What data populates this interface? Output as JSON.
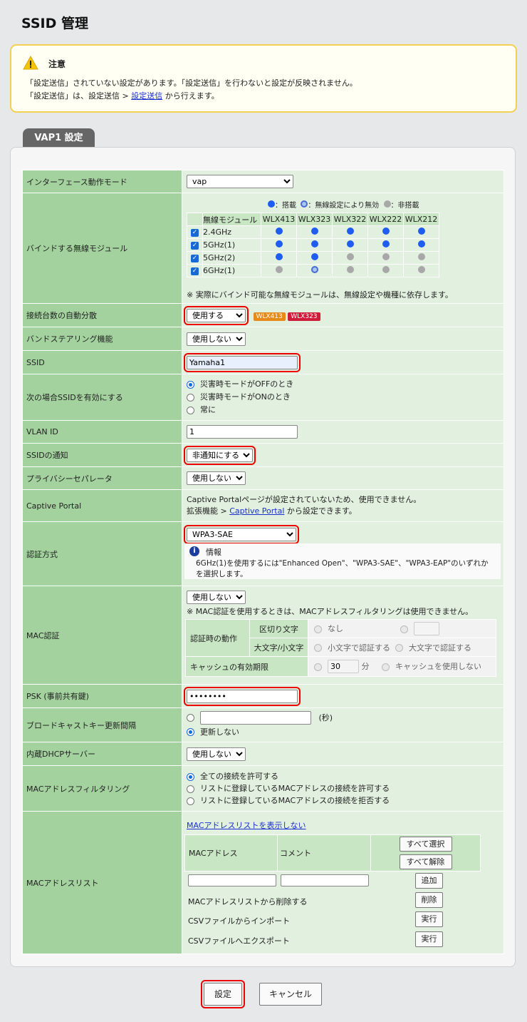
{
  "page_title": "SSID 管理",
  "notice": {
    "title": "注意",
    "line1": "「設定送信」されていない設定があります。「設定送信」を行わないと設定が反映されません。",
    "line2_pre": "「設定送信」は、設定送信 > ",
    "line2_link": "設定送信",
    "line2_post": " から行えます。"
  },
  "tab": "VAP1 設定",
  "rows": {
    "interface_mode": {
      "label": "インターフェース動作モード",
      "value": "vap"
    },
    "bind": {
      "label": "バインドする無線モジュール",
      "legend_on": "：搭載",
      "legend_disabled": "：無線設定により無効",
      "legend_none": "：非搭載",
      "col_module": "無線モジュール",
      "models": [
        "WLX413",
        "WLX323",
        "WLX322",
        "WLX222",
        "WLX212"
      ],
      "modules": [
        {
          "name": "2.4GHz",
          "dots": [
            "b",
            "b",
            "b",
            "b",
            "b"
          ]
        },
        {
          "name": "5GHz(1)",
          "dots": [
            "b",
            "b",
            "b",
            "b",
            "b"
          ]
        },
        {
          "name": "5GHz(2)",
          "dots": [
            "b",
            "b",
            "g",
            "g",
            "g"
          ]
        },
        {
          "name": "6GHz(1)",
          "dots": [
            "g",
            "r",
            "g",
            "g",
            "g"
          ]
        }
      ],
      "note": "※ 実際にバインド可能な無線モジュールは、無線設定や機種に依存します。"
    },
    "auto_distribution": {
      "label": "接続台数の自動分散",
      "value": "使用する",
      "tag1": "WLX413",
      "tag2": "WLX323"
    },
    "band_steering": {
      "label": "バンドステアリング機能",
      "value": "使用しない"
    },
    "ssid": {
      "label": "SSID",
      "value": "Yamaha1"
    },
    "enable_when": {
      "label": "次の場合SSIDを有効にする",
      "options": [
        "災害時モードがOFFのとき",
        "災害時モードがONのとき",
        "常に"
      ],
      "selected": 0
    },
    "vlan": {
      "label": "VLAN ID",
      "value": "1"
    },
    "ssid_notify": {
      "label": "SSIDの通知",
      "value": "非通知にする"
    },
    "privacy": {
      "label": "プライバシーセパレータ",
      "value": "使用しない"
    },
    "captive": {
      "label": "Captive Portal",
      "line1": "Captive Portalページが設定されていないため、使用できません。",
      "line2_pre": "拡張機能 > ",
      "line2_link": "Captive Portal",
      "line2_post": " から設定できます。"
    },
    "auth": {
      "label": "認証方式",
      "value": "WPA3-SAE",
      "info_title": "情報",
      "info_l1": "6GHz(1)を使用するには\"Enhanced Open\"、\"WPA3-SAE\"、\"WPA3-EAP\"のいずれか",
      "info_l2": "を選択します。"
    },
    "mac_auth": {
      "label": "MAC認証",
      "value": "使用しない",
      "note": "※ MAC認証を使用するときは、MACアドレスフィルタリングは使用できません。",
      "behavior": "認証時の動作",
      "delimiter": "区切り文字",
      "none": "なし",
      "case": "大文字/小文字",
      "lower": "小文字で認証する",
      "upper": "大文字で認証する",
      "cache": "キャッシュの有効期限",
      "cache_val": "30",
      "min": "分",
      "no_cache": "キャッシュを使用しない"
    },
    "psk": {
      "label": "PSK (事前共有鍵)",
      "value": "••••••••"
    },
    "broadcast": {
      "label": "ブロードキャストキー更新間隔",
      "unit": "(秒)",
      "no_update": "更新しない"
    },
    "dhcp": {
      "label": "内蔵DHCPサーバー",
      "value": "使用しない"
    },
    "mac_filter": {
      "label": "MACアドレスフィルタリング",
      "options": [
        "全ての接続を許可する",
        "リストに登録しているMACアドレスの接続を許可する",
        "リストに登録しているMACアドレスの接続を拒否する"
      ],
      "selected": 0
    },
    "mac_list": {
      "label": "MACアドレスリスト",
      "hide_link": "MACアドレスリストを表示しない",
      "col_mac": "MACアドレス",
      "col_comment": "コメント",
      "select_all": "すべて選択",
      "deselect_all": "すべて解除",
      "add": "追加",
      "delete_label": "MACアドレスリストから削除する",
      "delete": "削除",
      "import_label": "CSVファイルからインポート",
      "export_label": "CSVファイルへエクスポート",
      "run": "実行"
    }
  },
  "buttons": {
    "submit": "設定",
    "cancel": "キャンセル"
  }
}
